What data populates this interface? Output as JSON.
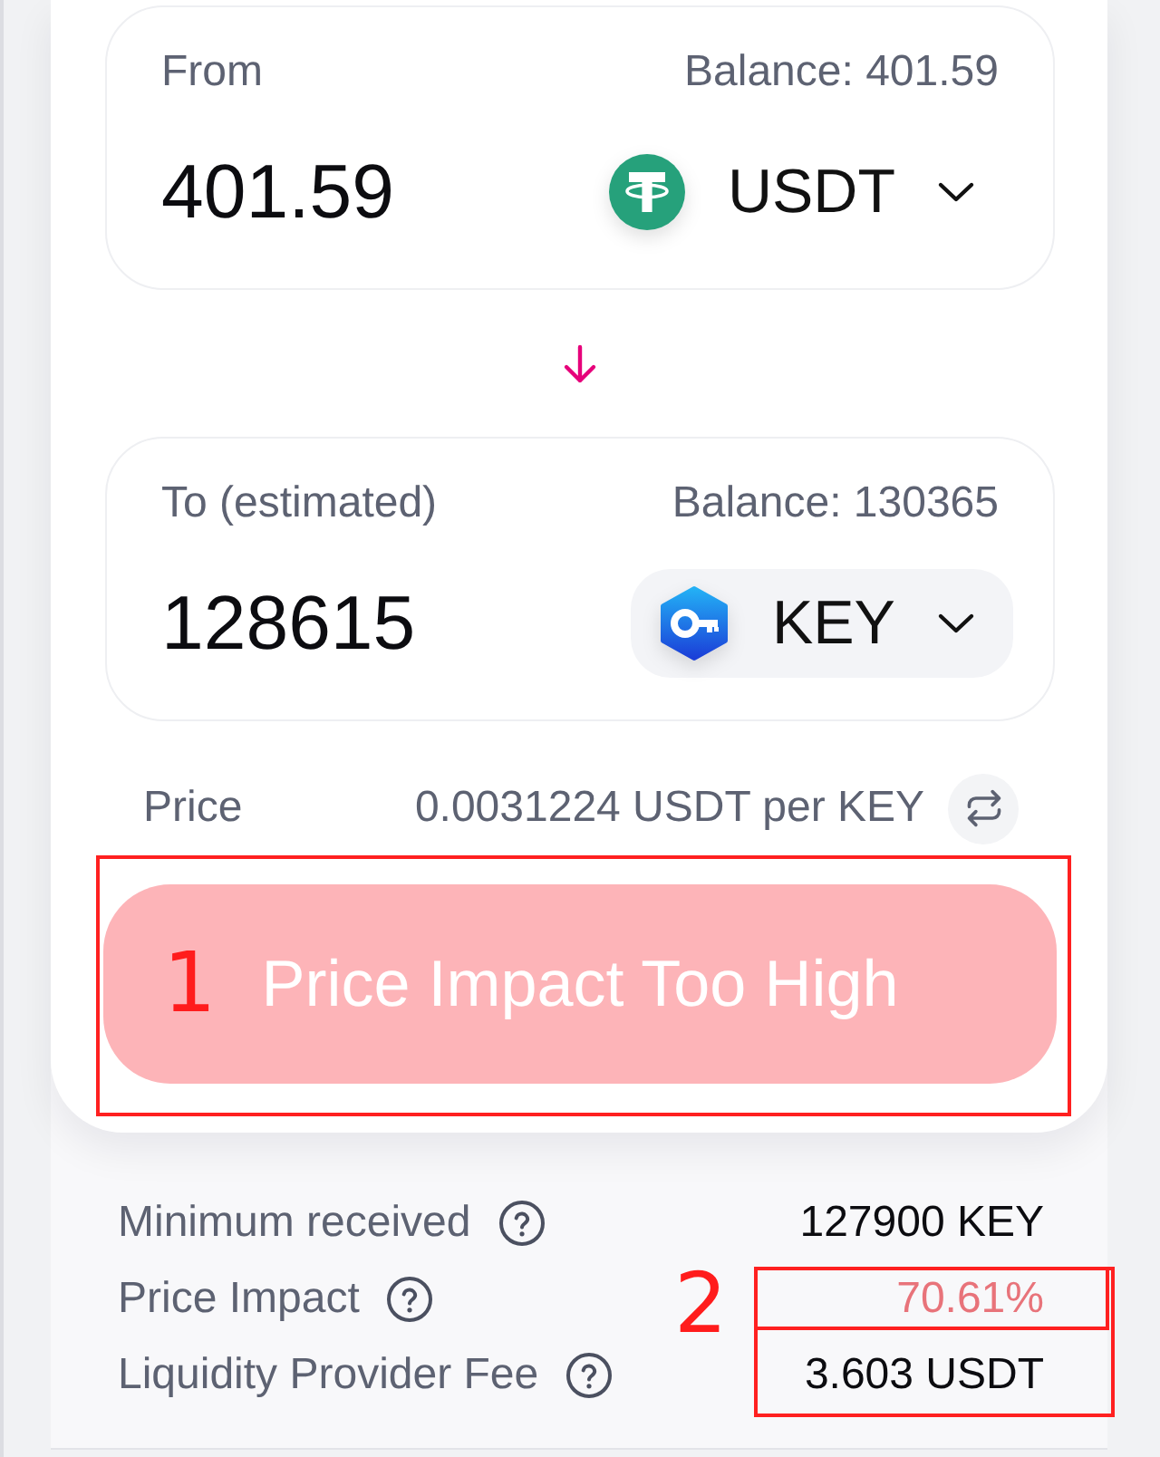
{
  "swap_form": {
    "inputs": [
      {
        "label": "From",
        "balance": "Balance: 401.59",
        "amount": "401.59",
        "token": {
          "symbol": "USDT",
          "kind": "tether",
          "highlighted": false
        }
      },
      {
        "label": "To (estimated)",
        "balance": "Balance: 130365",
        "amount": "128615",
        "token": {
          "symbol": "KEY",
          "kind": "key",
          "highlighted": true
        }
      }
    ],
    "price": {
      "label": "Price",
      "value": "0.0031224 USDT per KEY"
    },
    "submit_button": {
      "label": "Price Impact Too High",
      "disabled": true
    }
  },
  "details": [
    {
      "label": "Minimum received",
      "value": "127900 KEY",
      "warning": false
    },
    {
      "label": "Price Impact",
      "value": "70.61%",
      "warning": true
    },
    {
      "label": "Liquidity Provider Fee",
      "value": "3.603 USDT",
      "warning": false
    }
  ],
  "annotations": [
    {
      "label": "1"
    },
    {
      "label": "2"
    }
  ]
}
